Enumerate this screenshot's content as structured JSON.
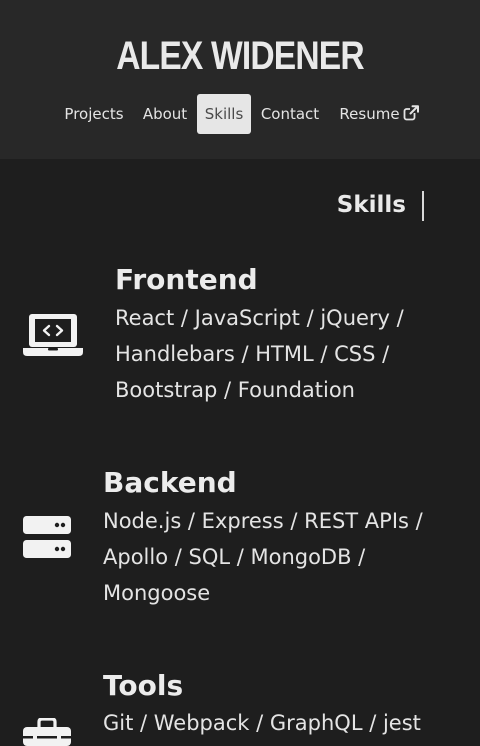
{
  "header": {
    "title": "ALEX WIDENER"
  },
  "nav": {
    "items": [
      {
        "label": "Projects"
      },
      {
        "label": "About"
      },
      {
        "label": "Skills"
      },
      {
        "label": "Contact"
      },
      {
        "label": "Resume"
      }
    ],
    "active": "Skills"
  },
  "section": {
    "title": "Skills"
  },
  "skills": [
    {
      "heading": "Frontend",
      "lines": [
        "React / JavaScript / jQuery /",
        "Handlebars / HTML / CSS /",
        "Bootstrap / Foundation"
      ],
      "icon": "laptop-code-icon"
    },
    {
      "heading": "Backend",
      "lines": [
        "Node.js / Express / REST APIs /",
        "Apollo / SQL / MongoDB /",
        "Mongoose"
      ],
      "icon": "server-icon"
    },
    {
      "heading": "Tools",
      "lines": [
        "Git / Webpack / GraphQL / jest"
      ],
      "icon": "toolbox-icon"
    }
  ],
  "colors": {
    "background": "#1e1e1e",
    "header_bg": "#282828",
    "active_nav_bg": "#e6e6e6",
    "text": "#e6e6e6"
  }
}
